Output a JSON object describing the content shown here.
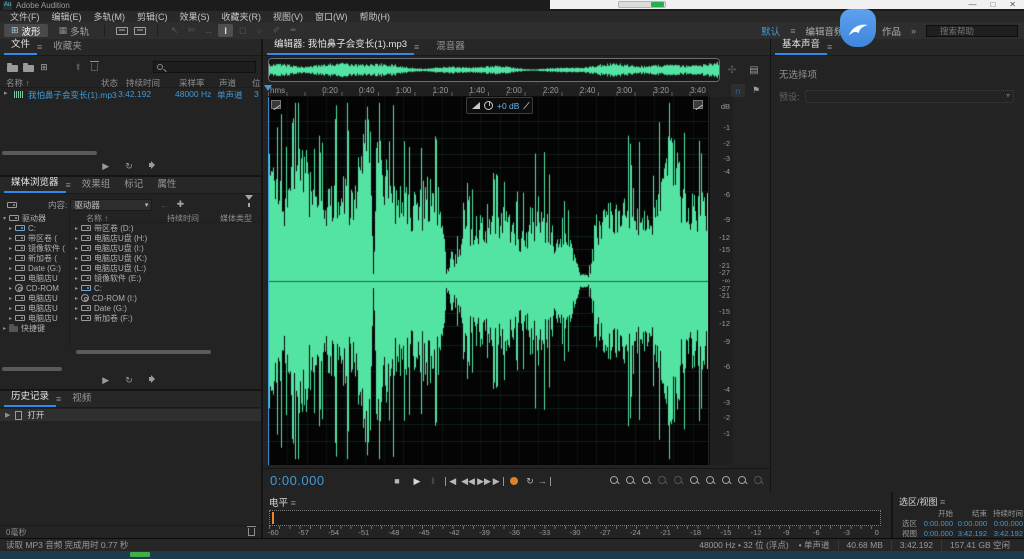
{
  "titlebar": {
    "app_title": "Adobe Audition",
    "logo": "Au",
    "window_controls": {
      "minimize": "—",
      "maximize": "□",
      "close": "✕"
    }
  },
  "menubar": {
    "items": [
      "文件(F)",
      "编辑(E)",
      "多轨(M)",
      "剪辑(C)",
      "效果(S)",
      "收藏夹(R)",
      "视图(V)",
      "窗口(W)",
      "帮助(H)"
    ]
  },
  "toolbar": {
    "waveform_label": "波形",
    "multitrack_label": "多轨",
    "workspace_selected": "默认",
    "workspace_menu": "≡",
    "workspace_tab1": "编辑音频到视频",
    "workspace_tab2": "作品",
    "overflow": "»",
    "search_placeholder": "搜索帮助"
  },
  "files_panel": {
    "tab_files": "文件",
    "tab_favorites": "收藏夹",
    "columns": {
      "name": "名称",
      "sort_arrow": "↑",
      "status": "状态",
      "duration": "持续时间",
      "sample_rate": "采样率",
      "channels": "声道",
      "bits": "位"
    },
    "row": {
      "name": "我怕鼻子会变长(1).mp3",
      "duration": "3:42.192",
      "sample_rate": "48000 Hz",
      "channels": "单声道",
      "bits": "3"
    }
  },
  "media_browser": {
    "tabs": [
      "媒体浏览器",
      "效果组",
      "标记",
      "属性"
    ],
    "content_label": "内容:",
    "content_value": "驱动器",
    "list_columns": {
      "name": "名称",
      "sort_arrow": "↑",
      "duration": "持续时间",
      "media_type": "媒体类型"
    },
    "tree_root": "驱动器",
    "tree_items": [
      "C:",
      "带区卷 (",
      "镜像软件 (",
      "新加卷 (",
      "Date (G:)",
      "电脑店U",
      "CD-ROM",
      "电脑店U",
      "电脑店U",
      "电脑店U"
    ],
    "tree_footer": "快捷键",
    "list_items": [
      "带区卷 (D:)",
      "电脑店U盘 (H:)",
      "电脑店U盘 (I:)",
      "电脑店U盘 (K:)",
      "电脑店U盘 (L:)",
      "镜像软件 (E:)",
      "C:",
      "CD-ROM (I:)",
      "Date (G:)",
      "新加卷 (F:)"
    ]
  },
  "history_panel": {
    "tab_history": "历史记录",
    "tab_video": "视频",
    "entry": "打开",
    "footer": "0毫秒"
  },
  "editor": {
    "tab_label": "编辑器: 我怕鼻子会变长(1).mp3",
    "panel_menu": "≡",
    "mixer_tab": "混音器",
    "ruler_unit": "hms",
    "ruler_labels": [
      "0:20",
      "0:40",
      "1:00",
      "1:20",
      "1:40",
      "2:00",
      "2:20",
      "2:40",
      "3:00",
      "3:20",
      "3:40"
    ],
    "db_unit": "dB",
    "db_ticks": [
      "-1",
      "-2",
      "-3",
      "-4",
      "-6",
      "-9",
      "-12",
      "-15",
      "-21",
      "-27"
    ],
    "db_center": "-∞",
    "hud_value": "+0 dB",
    "time_display": "0:00.000",
    "waveform_color": "#53e3a2",
    "accent_blue": "#2d8ceb"
  },
  "levels_panel": {
    "title": "电平",
    "panel_menu": "≡",
    "scale_min": -60,
    "scale_max": 0,
    "scale_step": 3
  },
  "selection_view_panel": {
    "title": "选区/视图",
    "panel_menu": "≡",
    "columns": {
      "start": "开始",
      "end": "结束",
      "duration": "持续时间"
    },
    "rows": [
      {
        "label": "选区",
        "start": "0:00.000",
        "end": "0:00.000",
        "duration": "0:00.000"
      },
      {
        "label": "视图",
        "start": "0:00.000",
        "end": "3:42.192",
        "duration": "3:42.192"
      }
    ]
  },
  "essential_sound_panel": {
    "title": "基本声音",
    "panel_menu": "≡",
    "empty_message": "无选择项",
    "preset_label": "预设:"
  },
  "status_bar": {
    "message": "读取 MP3 音频 完成用时 0.77 秒",
    "format": "48000 Hz • 32 位 (浮点)",
    "channel": "• 单声道",
    "size": "40.68 MB",
    "duration": "3:42.192",
    "free_space": "157.41 GB 空闲"
  }
}
